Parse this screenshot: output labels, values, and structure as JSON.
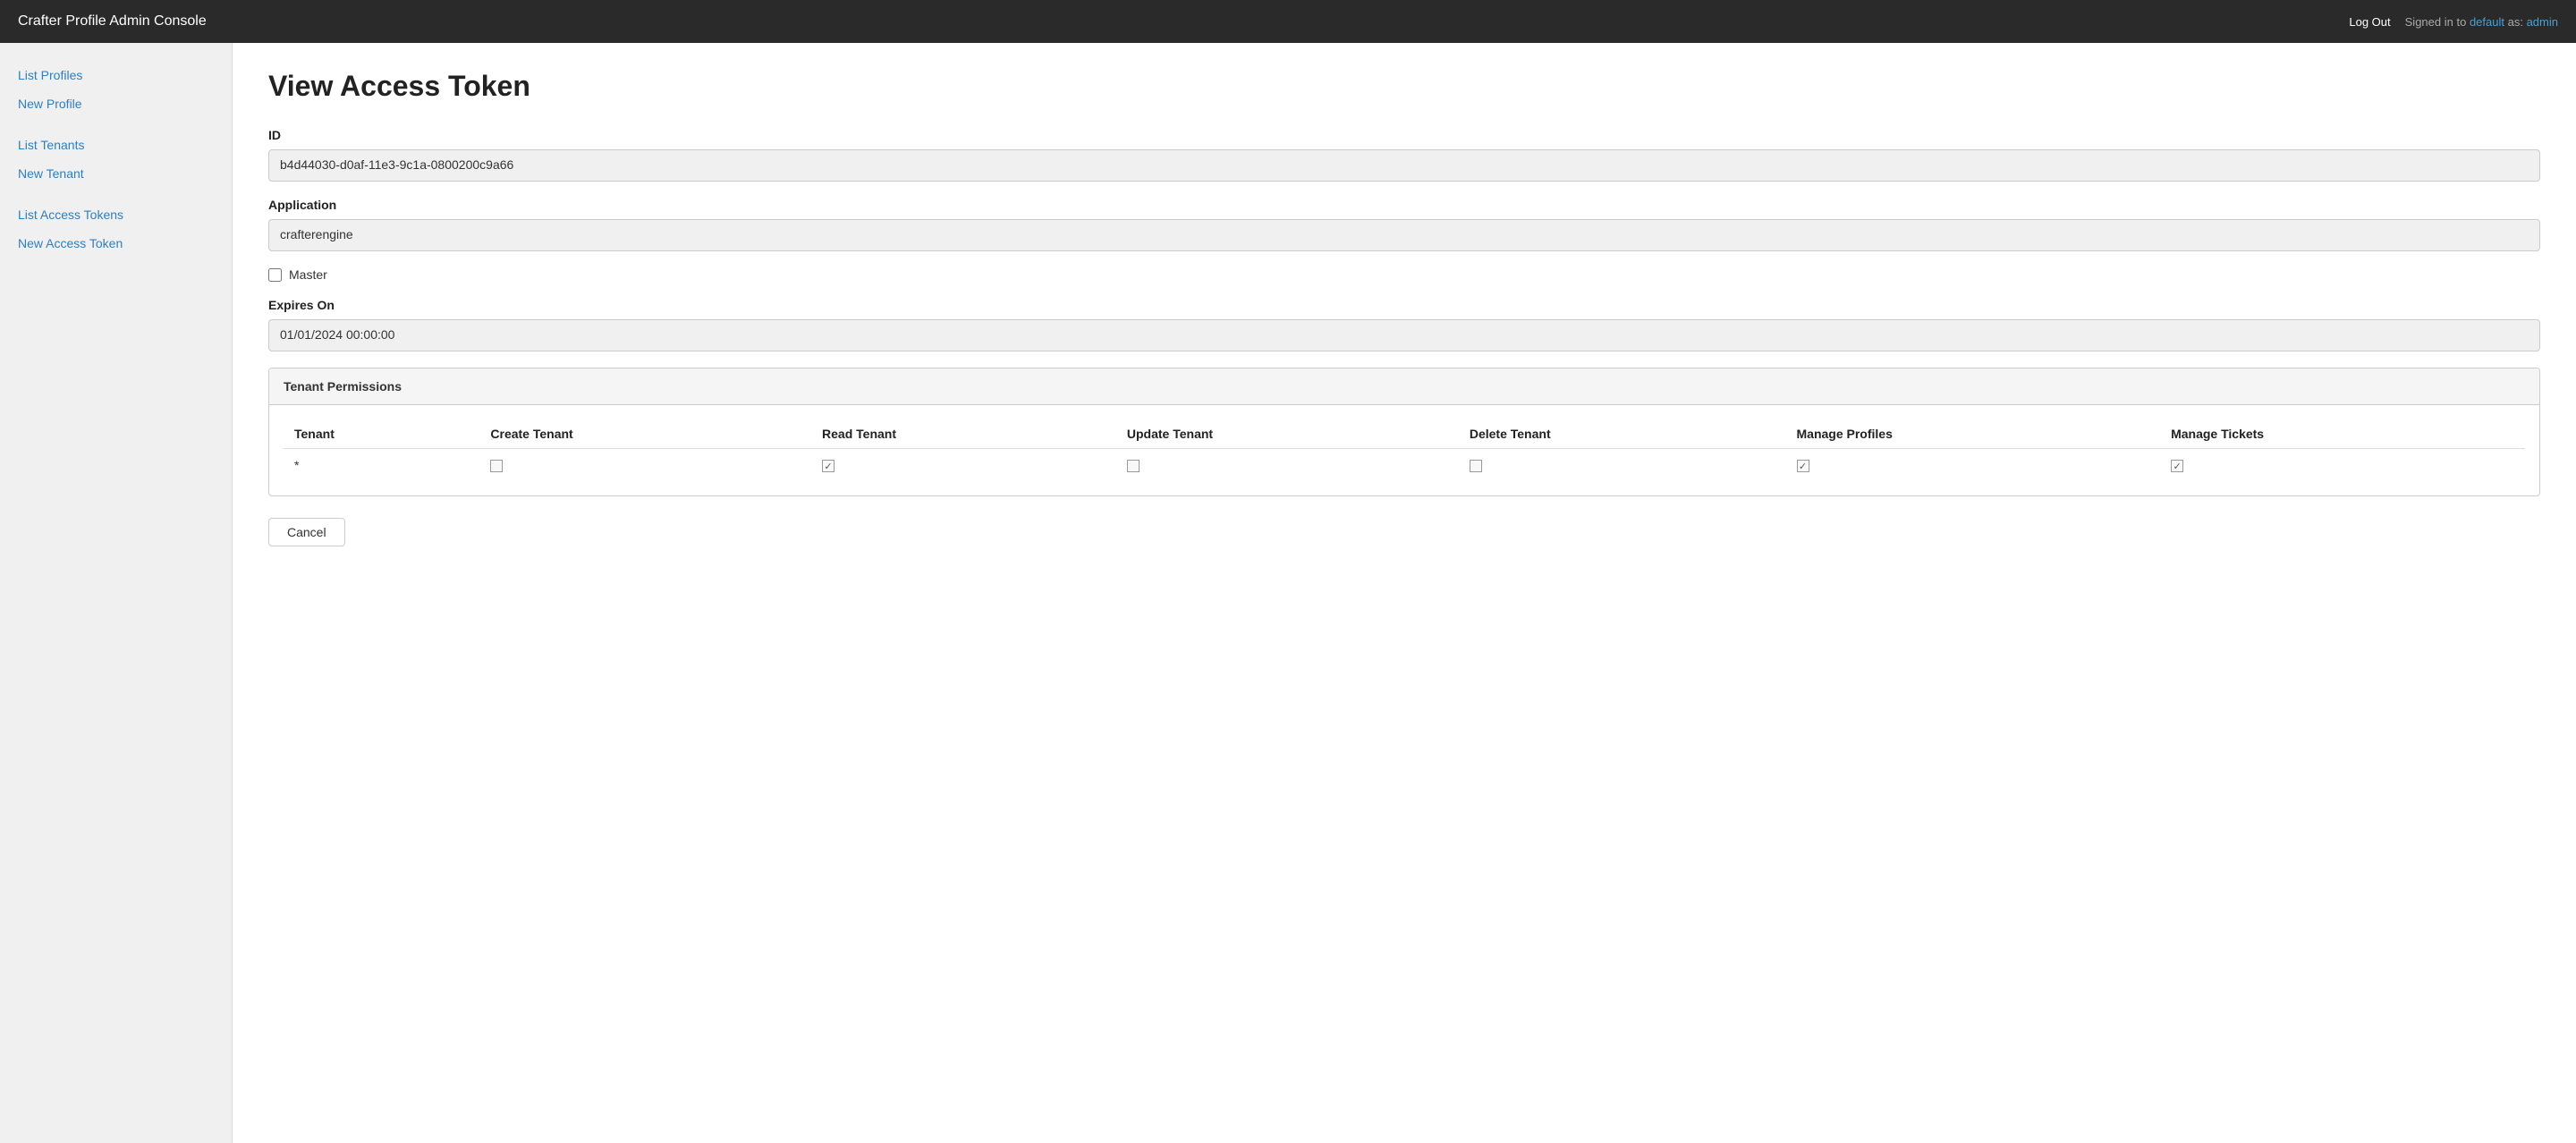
{
  "app": {
    "title": "Crafter Profile Admin Console"
  },
  "header": {
    "title": "Crafter Profile Admin Console",
    "logout_label": "Log Out",
    "signed_in_text": "Signed in to",
    "tenant_link": "default",
    "as_text": "as:",
    "user_link": "admin"
  },
  "sidebar": {
    "items": [
      {
        "id": "list-profiles",
        "label": "List Profiles"
      },
      {
        "id": "new-profile",
        "label": "New Profile"
      },
      {
        "id": "list-tenants",
        "label": "List Tenants"
      },
      {
        "id": "new-tenant",
        "label": "New Tenant"
      },
      {
        "id": "list-access-tokens",
        "label": "List Access Tokens"
      },
      {
        "id": "new-access-token",
        "label": "New Access Token"
      }
    ]
  },
  "main": {
    "page_title": "View Access Token",
    "id_label": "ID",
    "id_value": "b4d44030-d0af-11e3-9c1a-0800200c9a66",
    "application_label": "Application",
    "application_value": "crafterengine",
    "master_label": "Master",
    "master_checked": false,
    "expires_on_label": "Expires On",
    "expires_on_value": "01/01/2024 00:00:00",
    "permissions_panel_title": "Tenant Permissions",
    "table_headers": [
      "Tenant",
      "Create Tenant",
      "Read Tenant",
      "Update Tenant",
      "Delete Tenant",
      "Manage Profiles",
      "Manage Tickets"
    ],
    "table_rows": [
      {
        "tenant": "*",
        "create_tenant": false,
        "read_tenant": true,
        "update_tenant": false,
        "delete_tenant": false,
        "manage_profiles": true,
        "manage_tickets": true
      }
    ],
    "cancel_label": "Cancel"
  }
}
